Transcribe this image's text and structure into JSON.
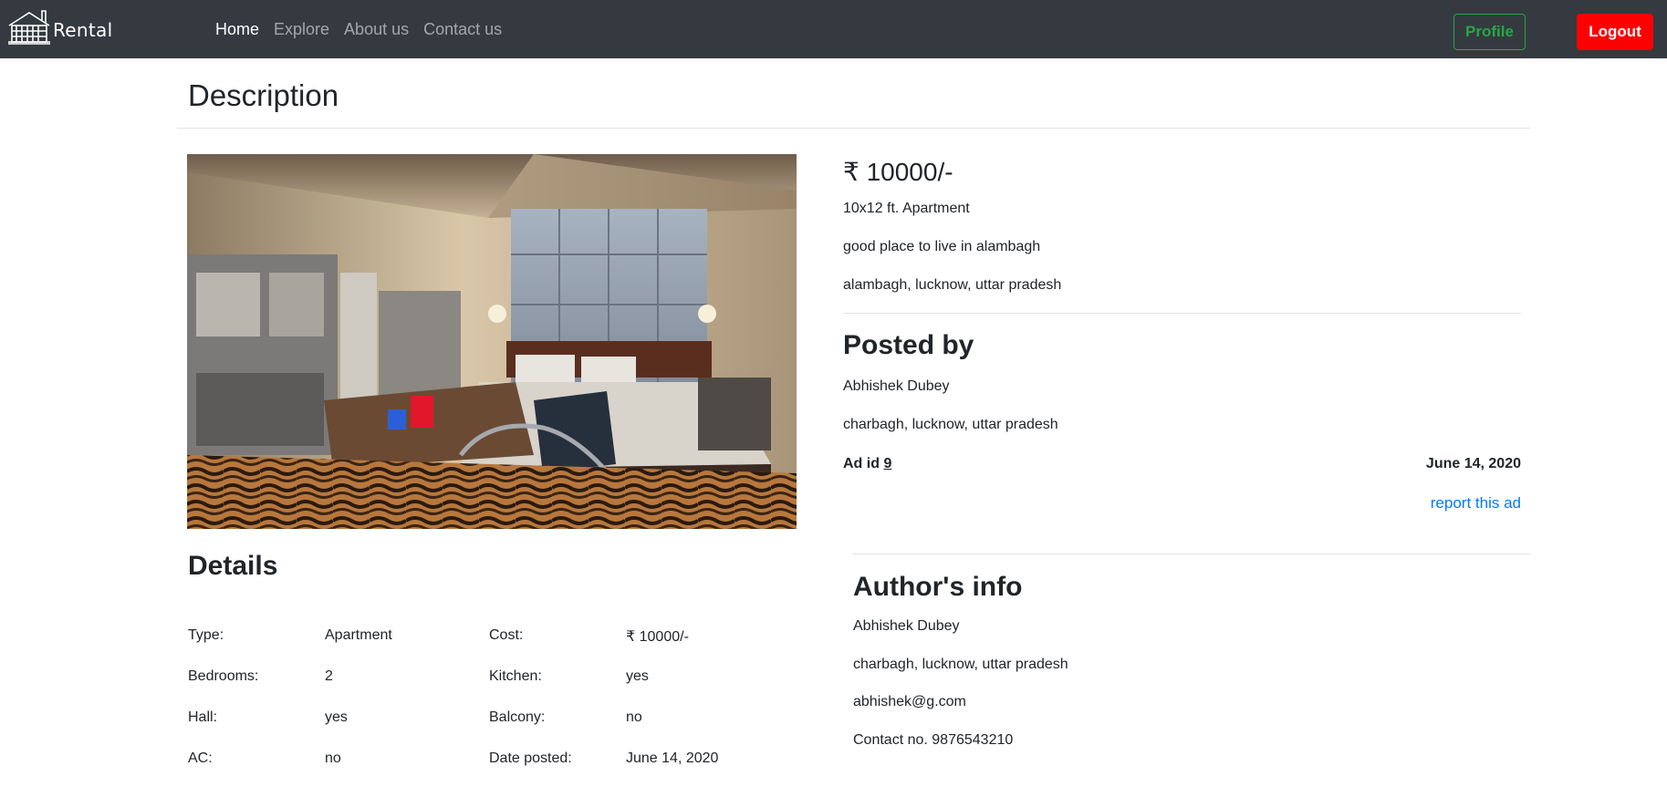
{
  "navbar": {
    "brand": "Rental",
    "links": [
      {
        "label": "Home",
        "active": true
      },
      {
        "label": "Explore",
        "active": false
      },
      {
        "label": "About us",
        "active": false
      },
      {
        "label": "Contact us",
        "active": false
      }
    ],
    "profile_label": "Profile",
    "logout_label": "Logout",
    "colors": {
      "profile": "#28a745",
      "logout": "#ff0000",
      "bg": "#343a40"
    }
  },
  "page": {
    "title": "Description"
  },
  "listing": {
    "price": "₹ 10000/-",
    "size": "10x12 ft. Apartment",
    "description": "good place to live in alambagh",
    "address": "alambagh, lucknow, uttar pradesh",
    "posted_by_heading": "Posted by",
    "poster_name": "Abhishek Dubey",
    "poster_address": "charbagh, lucknow, uttar pradesh",
    "ad_id_label": "Ad id",
    "ad_id": "9",
    "date": "June 14, 2020",
    "report_label": "report this ad",
    "report_color": "#007bff"
  },
  "details": {
    "heading": "Details",
    "rows": [
      {
        "label1": "Type:",
        "value1": "Apartment",
        "label2": "Cost:",
        "value2": "₹ 10000/-"
      },
      {
        "label1": "Bedrooms:",
        "value1": "2",
        "label2": "Kitchen:",
        "value2": "yes"
      },
      {
        "label1": "Hall:",
        "value1": "yes",
        "label2": "Balcony:",
        "value2": "no"
      },
      {
        "label1": "AC:",
        "value1": "no",
        "label2": "Date posted:",
        "value2": "June 14, 2020"
      }
    ]
  },
  "author": {
    "heading": "Author's info",
    "name": "Abhishek Dubey",
    "address": "charbagh, lucknow, uttar pradesh",
    "email": "abhishek@g.com",
    "contact": "Contact no. 9876543210"
  }
}
